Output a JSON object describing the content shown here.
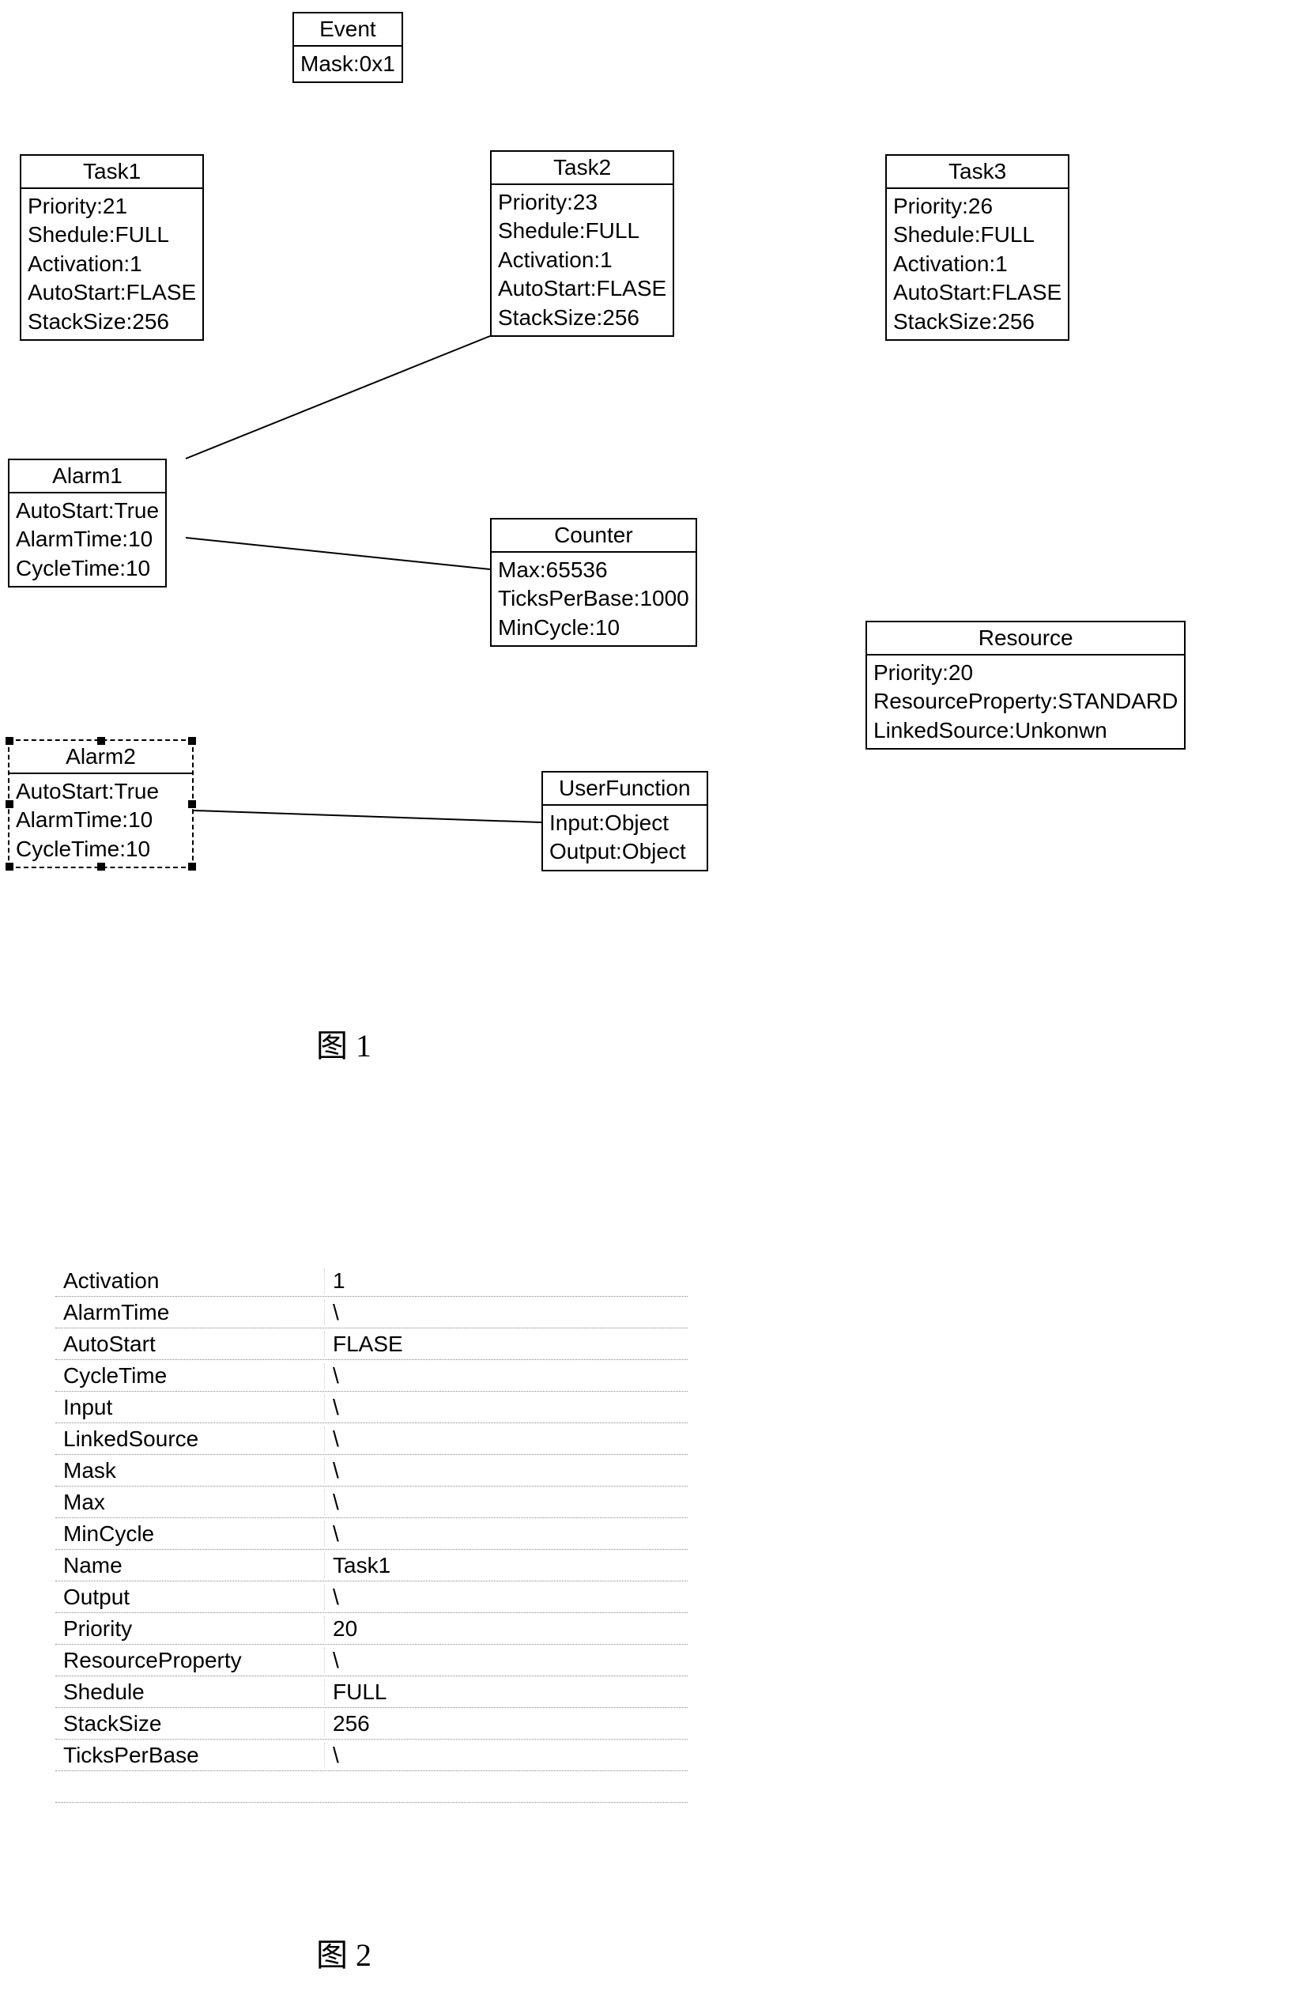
{
  "diagram": {
    "event": {
      "title": "Event",
      "mask": "Mask:0x1"
    },
    "task1": {
      "title": "Task1",
      "priority": "Priority:21",
      "schedule": "Shedule:FULL",
      "activation": "Activation:1",
      "autostart": "AutoStart:FLASE",
      "stacksize": "StackSize:256"
    },
    "task2": {
      "title": "Task2",
      "priority": "Priority:23",
      "schedule": "Shedule:FULL",
      "activation": "Activation:1",
      "autostart": "AutoStart:FLASE",
      "stacksize": "StackSize:256"
    },
    "task3": {
      "title": "Task3",
      "priority": "Priority:26",
      "schedule": "Shedule:FULL",
      "activation": "Activation:1",
      "autostart": "AutoStart:FLASE",
      "stacksize": "StackSize:256"
    },
    "alarm1": {
      "title": "Alarm1",
      "autostart": "AutoStart:True",
      "alarmtime": "AlarmTime:10",
      "cycletime": "CycleTime:10"
    },
    "alarm2": {
      "title": "Alarm2",
      "autostart": "AutoStart:True",
      "alarmtime": "AlarmTime:10",
      "cycletime": "CycleTime:10"
    },
    "counter": {
      "title": "Counter",
      "max": "Max:65536",
      "ticksperbase": "TicksPerBase:1000",
      "mincycle": "MinCycle:10"
    },
    "resource": {
      "title": "Resource",
      "priority": "Priority:20",
      "resourceproperty": "ResourceProperty:STANDARD",
      "linkedsource": "LinkedSource:Unkonwn"
    },
    "userfunction": {
      "title": "UserFunction",
      "input": "Input:Object",
      "output": "Output:Object"
    }
  },
  "figure1_label": "图   1",
  "figure2_label": "图   2",
  "properties": {
    "rows": [
      {
        "key": "Activation",
        "val": "1"
      },
      {
        "key": "AlarmTime",
        "val": "\\"
      },
      {
        "key": "AutoStart",
        "val": "FLASE"
      },
      {
        "key": "CycleTime",
        "val": "\\"
      },
      {
        "key": "Input",
        "val": "\\"
      },
      {
        "key": "LinkedSource",
        "val": "\\"
      },
      {
        "key": "Mask",
        "val": "\\"
      },
      {
        "key": "Max",
        "val": "\\"
      },
      {
        "key": "MinCycle",
        "val": "\\"
      },
      {
        "key": "Name",
        "val": "Task1"
      },
      {
        "key": "Output",
        "val": "\\"
      },
      {
        "key": "Priority",
        "val": "20"
      },
      {
        "key": "ResourceProperty",
        "val": "\\"
      },
      {
        "key": "Shedule",
        "val": "FULL"
      },
      {
        "key": "StackSize",
        "val": "256"
      },
      {
        "key": "TicksPerBase",
        "val": "\\"
      }
    ]
  }
}
